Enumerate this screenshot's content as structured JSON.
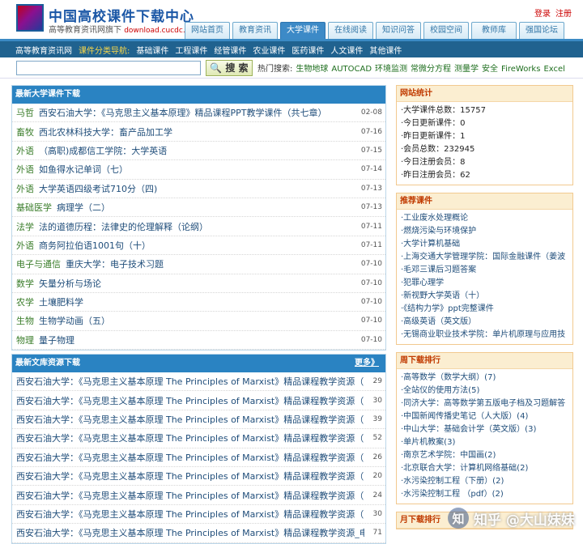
{
  "header": {
    "title": "中国高校课件下载中心",
    "subtitle": "高等教育资讯网旗下",
    "domain": "download.cucdc.com",
    "login": "登录",
    "register": "注册"
  },
  "nav": {
    "tabs": [
      "网站首页",
      "教育资讯",
      "大学课件",
      "在线阅读",
      "知识问答",
      "校园空间",
      "教师库",
      "强国论坛"
    ],
    "active_index": 2
  },
  "subnav": {
    "items": [
      "高等教育资讯网",
      "课件分类导航:",
      "基础课件",
      "工程课件",
      "经管课件",
      "农业课件",
      "医药课件",
      "人文课件",
      "其他课件"
    ]
  },
  "search": {
    "placeholder": "",
    "button": "搜 索",
    "hot_label": "热门搜索:",
    "keywords": [
      "生物地球",
      "AUTOCAD",
      "环境监测",
      "常微分方程",
      "测量学",
      "安全",
      "FireWorks",
      "Excel"
    ]
  },
  "latest_courses": {
    "title": "最新大学课件下载",
    "rows": [
      {
        "cat": "马哲",
        "title": "西安石油大学：《马克思主义基本原理》精品课程PPT教学课件（共七章）",
        "date": "02-08"
      },
      {
        "cat": "畜牧",
        "title": "西北农林科技大学：畜产品加工学",
        "date": "07-16"
      },
      {
        "cat": "外语",
        "title": "（高职)成都信工学院：大学英语",
        "date": "07-15"
      },
      {
        "cat": "外语",
        "title": "如鱼得水记单词（七）",
        "date": "07-14"
      },
      {
        "cat": "外语",
        "title": "大学英语四级考试710分（四)",
        "date": "07-13"
      },
      {
        "cat": "基础医学",
        "title": "病理学（二）",
        "date": "07-13"
      },
      {
        "cat": "法学",
        "title": "法的道德历程：法律史的伦理解释（论纲）",
        "date": "07-11"
      },
      {
        "cat": "外语",
        "title": "商务阿拉伯语1001句（十）",
        "date": "07-11"
      },
      {
        "cat": "电子与通信",
        "title": "重庆大学：电子技术习题",
        "date": "07-10"
      },
      {
        "cat": "数学",
        "title": "矢量分析与场论",
        "date": "07-10"
      },
      {
        "cat": "农学",
        "title": "土壤肥料学",
        "date": "07-10"
      },
      {
        "cat": "生物",
        "title": "生物学动画（五）",
        "date": "07-10"
      },
      {
        "cat": "物理",
        "title": "量子物理",
        "date": "07-10"
      }
    ]
  },
  "latest_docs": {
    "title": "最新文库资源下载",
    "more": "更多》",
    "rows": [
      {
        "title": "西安石油大学：《马克思主义基本原理 The Principles of Marxist》精品课程教学资源（PPT课",
        "num": "29"
      },
      {
        "title": "西安石油大学：《马克思主义基本原理 The Principles of Marxist》精品课程教学资源（PPT课",
        "num": "30"
      },
      {
        "title": "西安石油大学：《马克思主义基本原理 The Principles of Marxist》精品课程教学资源（PPT课",
        "num": "39"
      },
      {
        "title": "西安石油大学：《马克思主义基本原理 The Principles of Marxist》精品课程教学资源（PPT课",
        "num": "52"
      },
      {
        "title": "西安石油大学：《马克思主义基本原理 The Principles of Marxist》精品课程教学资源（PPT课",
        "num": "26"
      },
      {
        "title": "西安石油大学：《马克思主义基本原理 The Principles of Marxist》精品课程教学资源（PPT课",
        "num": "20"
      },
      {
        "title": "西安石油大学：《马克思主义基本原理 The Principles of Marxist》精品课程教学资源（PPT课",
        "num": "24"
      },
      {
        "title": "西安石油大学：《马克思主义基本原理 The Principles of Marxist》精品课程教学资源（PPT课",
        "num": "30"
      },
      {
        "title": "西安石油大学：《马克思主义基本原理 The Principles of Marxist》精品课程教学资源_电子讲稿",
        "num": "71"
      }
    ]
  },
  "stats": {
    "title": "网站统计",
    "items": [
      "·大学课件总数：15757",
      "·今日更新课件：0",
      "·昨日更新课件：1",
      "·会员总数：232945",
      "·今日注册会员：8",
      "·昨日注册会员：62"
    ]
  },
  "recommended": {
    "title": "推荐课件",
    "items": [
      "·工业废水处理概论",
      "·燃烧污染与环境保护",
      "·大学计算机基础",
      "·上海交通大学管理学院：国际金融课件（姜波",
      "·毛邓三课后习题答案",
      "·犯罪心理学",
      "·新视野大学英语（十）",
      "·《结构力学》ppt完整课件",
      "·高级英语（英文版）",
      "·无锡商业职业技术学院：单片机原理与应用技"
    ]
  },
  "weekly_rank": {
    "title": "周下载排行",
    "items": [
      "·高等数学（数学大纲）(7)",
      "·全站仪的使用方法(5)",
      "·同济大学：高等数学第五版电子档及习题解答",
      "·中国新闻传播史笔记（人大版）(4)",
      "·中山大学：基础会计学（英文版）(3)",
      "·单片机教案(3)",
      "·南京艺术学院：中国画(2)",
      "·北京联合大学：计算机网络基础(2)",
      "·水污染控制工程（下册）(2)",
      "·水污染控制工程 （pdf）(2)"
    ]
  },
  "monthly_rank": {
    "title": "月下载排行"
  },
  "watermark": {
    "text": "知乎 @大山妹妹",
    "icon": "zhihu-logo-icon"
  }
}
